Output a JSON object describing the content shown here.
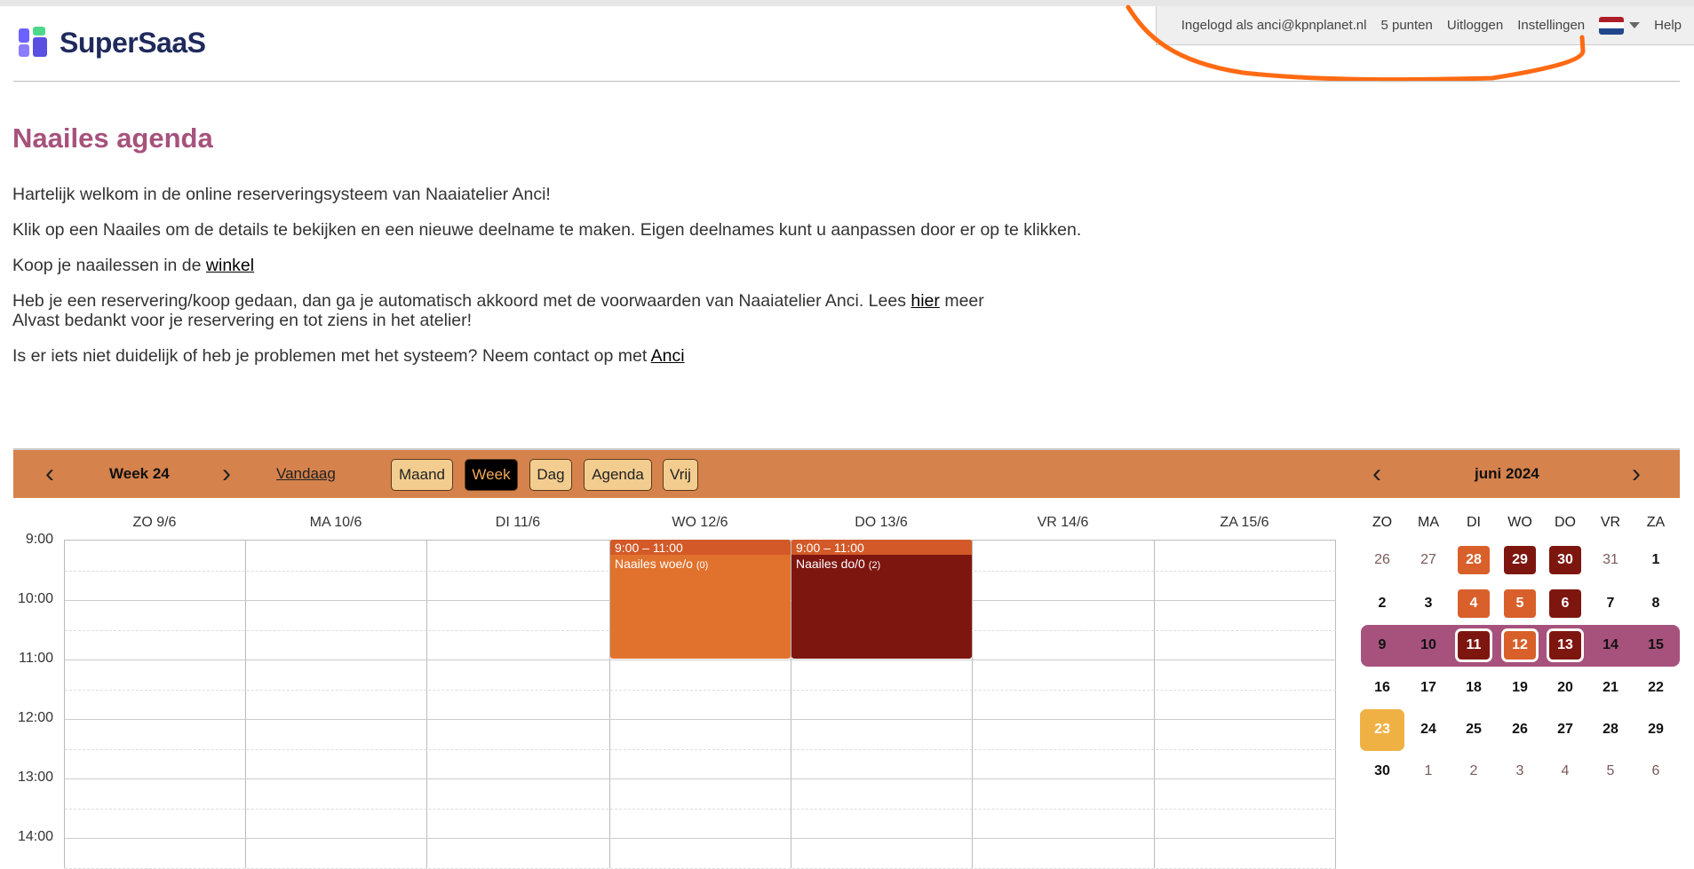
{
  "header": {
    "logged_in": "Ingelogd als anci@kpnplanet.nl",
    "points": "5 punten",
    "logout": "Uitloggen",
    "settings": "Instellingen",
    "help": "Help",
    "logo": "SuperSaaS"
  },
  "page": {
    "title": "Naailes agenda",
    "p1": "Hartelijk welkom in de online reserveringsysteem van Naaiatelier Anci!",
    "p2": "Klik op een Naailes om de details te bekijken en een nieuwe deelname te maken. Eigen deelnames kunt u aanpassen door er op te klikken.",
    "p3": "Koop je naailessen in de ",
    "p3_link": "winkel",
    "p4a": "Heb je een reservering/koop gedaan, dan ga je automatisch akkoord met de voorwaarden van Naaiatelier Anci. Lees ",
    "p4_link": "hier",
    "p4b": " meer",
    "p4c": "Alvast bedankt voor je reservering en tot ziens in het atelier!",
    "p5": "Is er iets niet duidelijk of heb je problemen met het systeem? Neem contact op met ",
    "p5_link": "Anci"
  },
  "toolbar": {
    "week": "Week 24",
    "today": "Vandaag",
    "views": [
      "Maand",
      "Week",
      "Dag",
      "Agenda",
      "Vrij"
    ],
    "active_view": "Week",
    "month": "juni 2024"
  },
  "days": [
    "ZO 9/6",
    "MA 10/6",
    "DI 11/6",
    "WO 12/6",
    "DO 13/6",
    "VR 14/6",
    "ZA 15/6"
  ],
  "times": [
    "9:00",
    "10:00",
    "11:00",
    "12:00",
    "13:00",
    "14:00"
  ],
  "events": [
    {
      "day": 3,
      "time": "9:00 – 11:00",
      "name": "Naailes woe/o",
      "count": "(0)",
      "color": "#e0722e",
      "head": "#d35a28"
    },
    {
      "day": 4,
      "time": "9:00 – 11:00",
      "name": "Naailes do/0",
      "count": "(2)",
      "color": "#7e1610",
      "head": "#d35a28"
    }
  ],
  "mini": {
    "weekdays": [
      "ZO",
      "MA",
      "DI",
      "WO",
      "DO",
      "VR",
      "ZA"
    ],
    "weeks": [
      [
        "26",
        "27",
        "28",
        "29",
        "30",
        "31",
        "1"
      ],
      [
        "2",
        "3",
        "4",
        "5",
        "6",
        "7",
        "8"
      ],
      [
        "9",
        "10",
        "11",
        "12",
        "13",
        "14",
        "15"
      ],
      [
        "16",
        "17",
        "18",
        "19",
        "20",
        "21",
        "22"
      ],
      [
        "23",
        "24",
        "25",
        "26",
        "27",
        "28",
        "29"
      ],
      [
        "30",
        "1",
        "2",
        "3",
        "4",
        "5",
        "6"
      ]
    ],
    "colors": {
      "#e0722e": "open",
      "#7e1610": "full",
      "#a6527c": "selected-week",
      "#f0b144": "today"
    }
  }
}
